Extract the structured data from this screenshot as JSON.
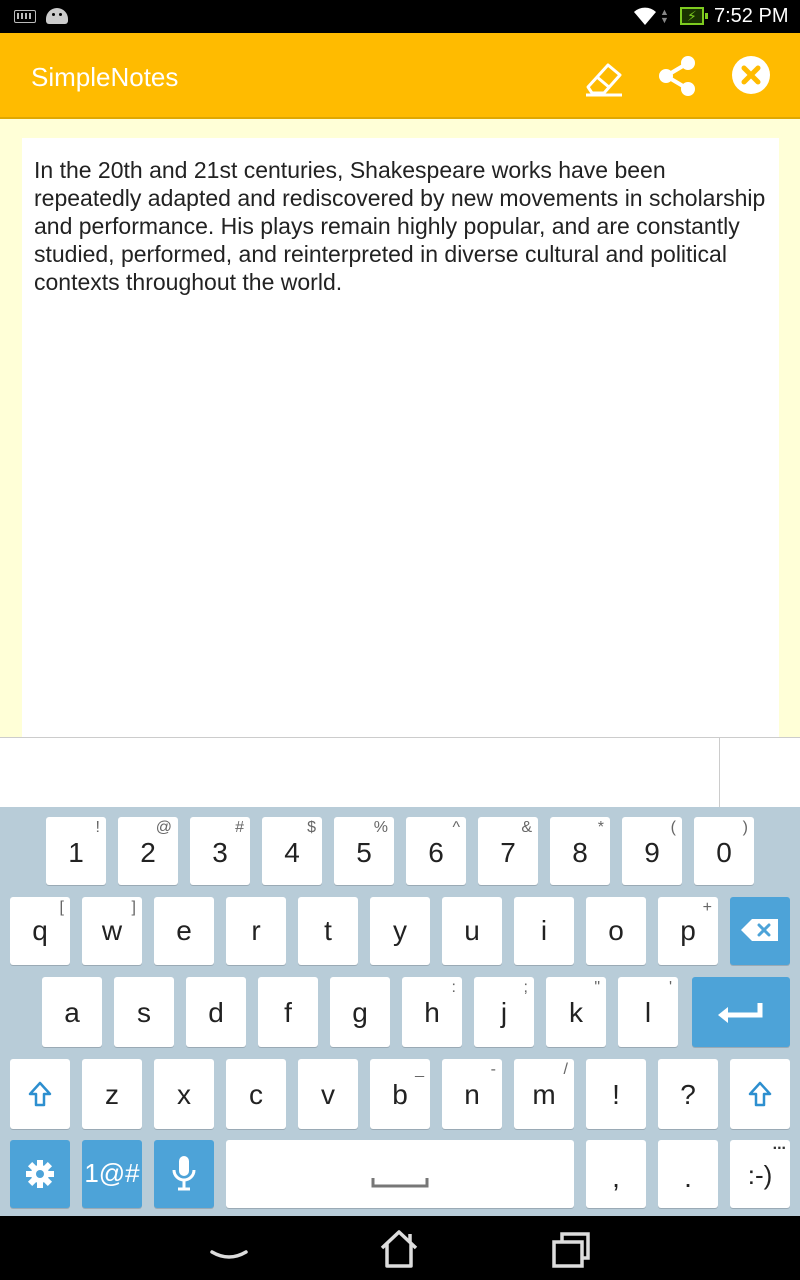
{
  "status_bar": {
    "time": "7:52 PM",
    "icons": [
      "keyboard-icon",
      "android-debug-icon",
      "wifi-icon",
      "data-arrows-icon",
      "battery-charging-icon"
    ]
  },
  "action_bar": {
    "title": "SimpleNotes",
    "background_color": "#ffbb00",
    "actions": [
      "eraser-icon",
      "share-icon",
      "close-icon"
    ]
  },
  "note": {
    "text": "In the 20th and 21st centuries, Shakespeare works have been repeatedly adapted and rediscovered by new movements in scholarship and performance. His plays remain highly popular, and are constantly studied, performed, and reinterpreted in diverse cultural and political contexts throughout the world."
  },
  "keyboard": {
    "accent_color": "#4da3d8",
    "row1": [
      {
        "main": "1",
        "hint": "!"
      },
      {
        "main": "2",
        "hint": "@"
      },
      {
        "main": "3",
        "hint": "#"
      },
      {
        "main": "4",
        "hint": "$"
      },
      {
        "main": "5",
        "hint": "%"
      },
      {
        "main": "6",
        "hint": "^"
      },
      {
        "main": "7",
        "hint": "&"
      },
      {
        "main": "8",
        "hint": "*"
      },
      {
        "main": "9",
        "hint": "("
      },
      {
        "main": "0",
        "hint": ")"
      }
    ],
    "row2": [
      {
        "main": "q",
        "hint": "["
      },
      {
        "main": "w",
        "hint": "]"
      },
      {
        "main": "e",
        "hint": ""
      },
      {
        "main": "r",
        "hint": ""
      },
      {
        "main": "t",
        "hint": ""
      },
      {
        "main": "y",
        "hint": ""
      },
      {
        "main": "u",
        "hint": ""
      },
      {
        "main": "i",
        "hint": ""
      },
      {
        "main": "o",
        "hint": ""
      },
      {
        "main": "p",
        "hint": "+"
      }
    ],
    "row3": [
      {
        "main": "a",
        "hint": ""
      },
      {
        "main": "s",
        "hint": ""
      },
      {
        "main": "d",
        "hint": ""
      },
      {
        "main": "f",
        "hint": ""
      },
      {
        "main": "g",
        "hint": ""
      },
      {
        "main": "h",
        "hint": ":"
      },
      {
        "main": "j",
        "hint": ";"
      },
      {
        "main": "k",
        "hint": "\""
      },
      {
        "main": "l",
        "hint": "'"
      }
    ],
    "row4": [
      {
        "main": "z",
        "hint": ""
      },
      {
        "main": "x",
        "hint": ""
      },
      {
        "main": "c",
        "hint": ""
      },
      {
        "main": "v",
        "hint": ""
      },
      {
        "main": "b",
        "hint": "_"
      },
      {
        "main": "n",
        "hint": "-"
      },
      {
        "main": "m",
        "hint": "/"
      },
      {
        "main": "!",
        "hint": ""
      },
      {
        "main": "?",
        "hint": ""
      }
    ],
    "symbols_label": "1@#",
    "comma": ",",
    "period": ".",
    "emoticon": ":-)",
    "emoticon_hint": "..."
  },
  "nav_bar": {
    "icons": [
      "back-icon",
      "home-icon",
      "recents-icon"
    ]
  }
}
